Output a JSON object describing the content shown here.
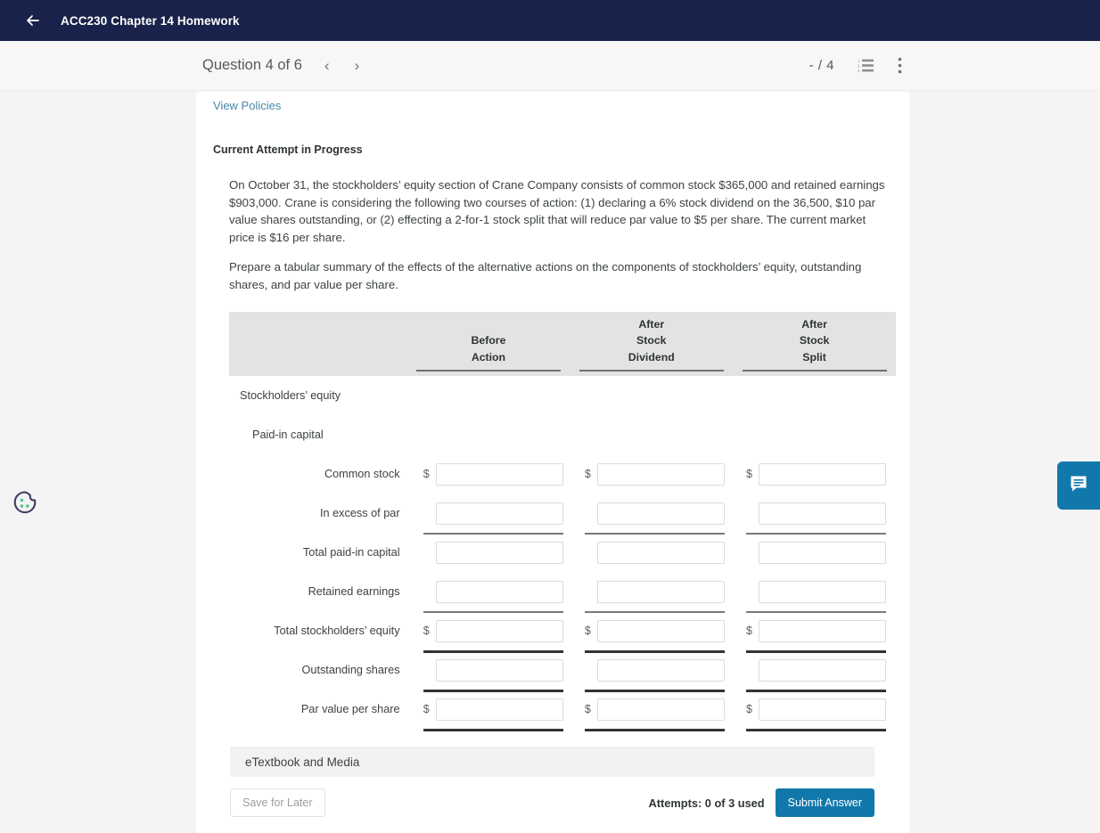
{
  "appbar": {
    "back_icon": "back-arrow-icon",
    "title": "ACC230 Chapter 14 Homework",
    "background": "#18224a"
  },
  "toolbar": {
    "question_label": "Question 4 of 6",
    "prev_icon": "chevron-left-icon",
    "next_icon": "chevron-right-icon",
    "prev_label": "‹",
    "next_label": "›",
    "score": "- / 4",
    "list_icon": "numbered-list-icon",
    "more_icon": "kebab-menu-icon"
  },
  "content": {
    "view_policies": "View Policies",
    "attempt_status": "Current Attempt in Progress",
    "paragraphs": [
      "On October 31, the stockholders’ equity section of Crane Company consists of common stock $365,000 and retained earnings $903,000. Crane is considering the following two courses of action: (1) declaring a 6% stock dividend on the 36,500, $10 par value shares outstanding, or (2) effecting a 2-for-1 stock split that will reduce par value to $5 per share. The current market price is $16 per share.",
      "Prepare a tabular summary of the effects of the alternative actions on the components of stockholders’ equity, outstanding shares, and par value per share."
    ]
  },
  "table": {
    "columns": [
      {
        "lines": [
          "Before",
          "Action"
        ],
        "key": "before_action"
      },
      {
        "lines": [
          "After",
          "Stock",
          "Dividend"
        ],
        "key": "after_stock_dividend"
      },
      {
        "lines": [
          "After",
          "Stock",
          "Split"
        ],
        "key": "after_stock_split"
      }
    ],
    "rows": [
      {
        "label": "Stockholders’ equity",
        "type": "section",
        "indent": 0
      },
      {
        "label": "Paid-in capital",
        "type": "section",
        "indent": 1
      },
      {
        "label": "Common stock",
        "type": "input",
        "indent": 2,
        "dollar": true,
        "values": [
          "",
          "",
          ""
        ],
        "rule_after": "none"
      },
      {
        "label": "In excess of par",
        "type": "input",
        "indent": 2,
        "dollar": false,
        "values": [
          "",
          "",
          ""
        ],
        "rule_after": "thin"
      },
      {
        "label": "Total paid-in capital",
        "type": "input",
        "indent": 3,
        "dollar": false,
        "values": [
          "",
          "",
          ""
        ],
        "rule_after": "none"
      },
      {
        "label": "Retained earnings",
        "type": "input",
        "indent": 2,
        "dollar": false,
        "values": [
          "",
          "",
          ""
        ],
        "rule_after": "thin"
      },
      {
        "label": "Total stockholders’ equity",
        "type": "input",
        "indent": 3,
        "dollar": true,
        "values": [
          "",
          "",
          ""
        ],
        "rule_after": "thick"
      },
      {
        "label": "Outstanding shares",
        "type": "input",
        "indent": 1,
        "dollar": false,
        "values": [
          "",
          "",
          ""
        ],
        "rule_after": "thick"
      },
      {
        "label": "Par value per share",
        "type": "input",
        "indent": 1,
        "dollar": true,
        "values": [
          "",
          "",
          ""
        ],
        "rule_after": "thick"
      }
    ],
    "dollar_symbol": "$",
    "header_background": "#e3e3e3"
  },
  "footer": {
    "etextbook_label": "eTextbook and Media",
    "save_label": "Save for Later",
    "attempts_label": "Attempts: 0 of 3 used",
    "submit_label": "Submit Answer",
    "submit_color": "#1178ab"
  },
  "widgets": {
    "cookie_icon": "cookie-consent-icon",
    "chat_icon": "chat-bubble-icon",
    "chat_color": "#1178ab"
  }
}
